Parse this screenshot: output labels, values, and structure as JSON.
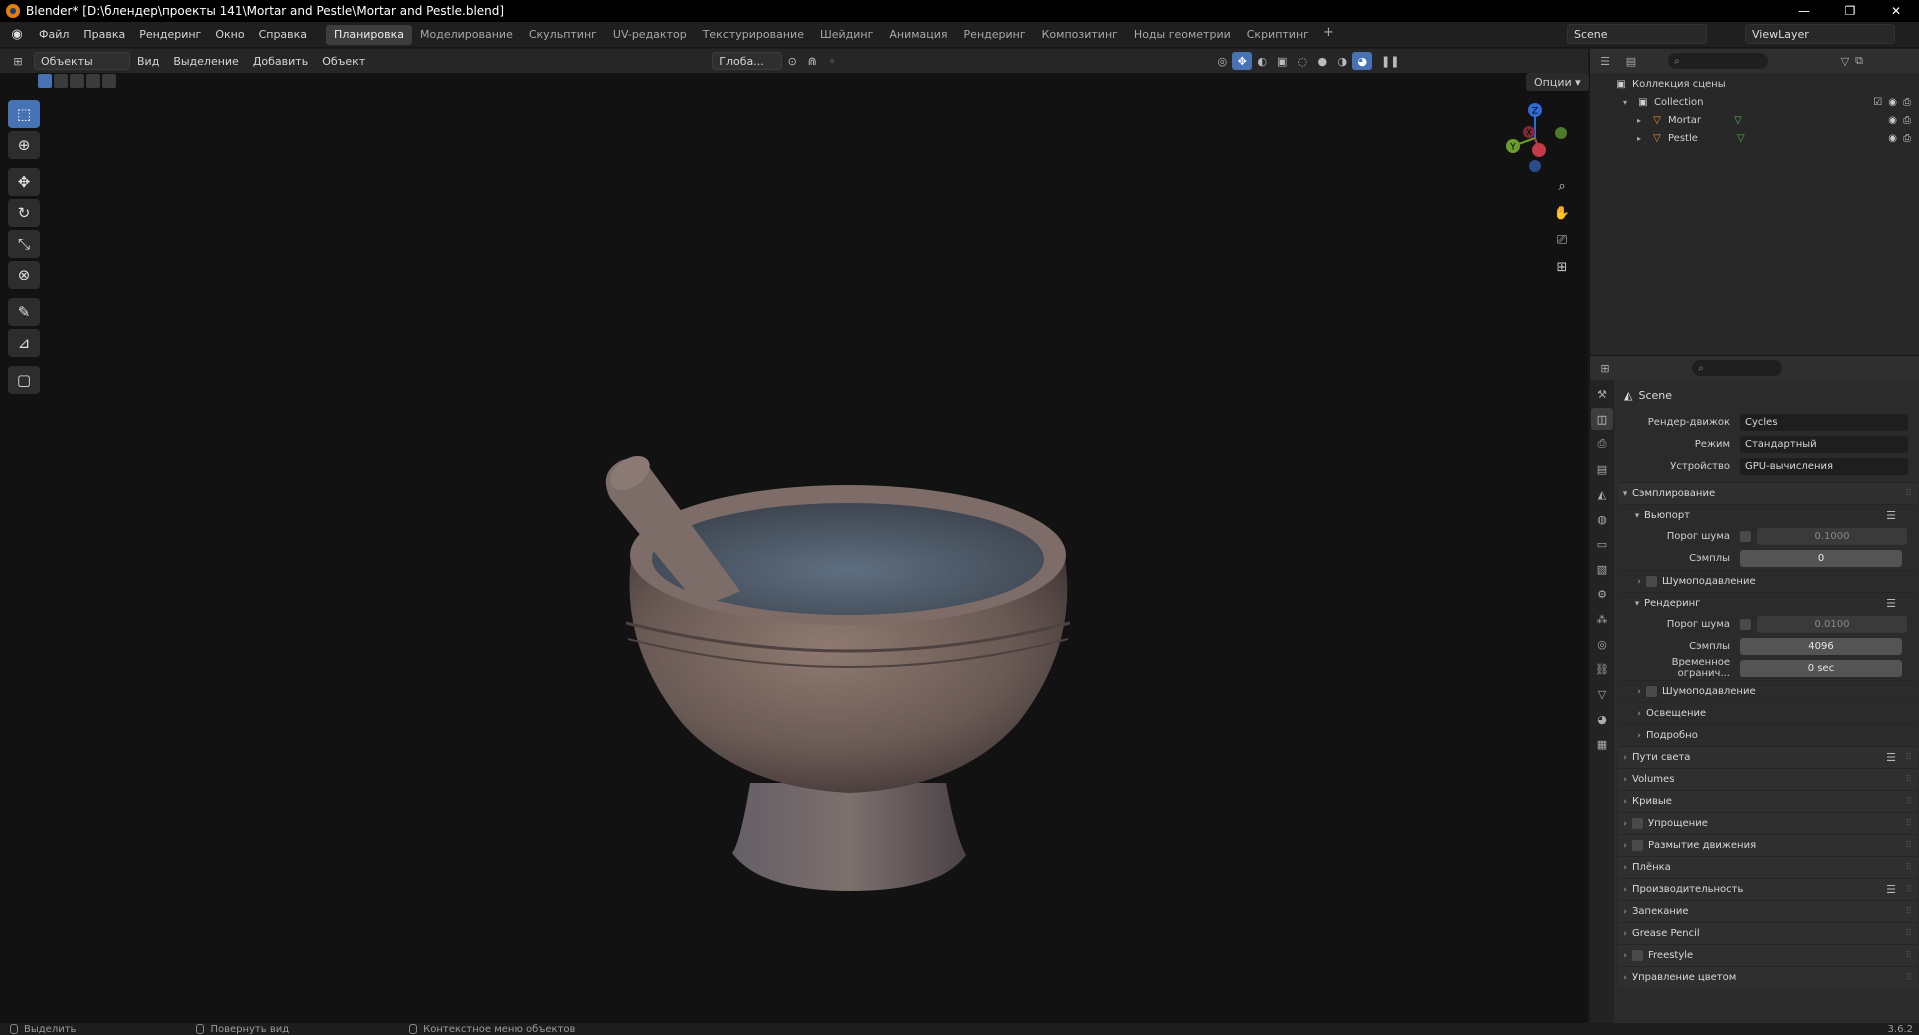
{
  "window": {
    "title": "Blender* [D:\\блендер\\проекты 141\\Mortar and Pestle\\Mortar and Pestle.blend]",
    "controls": [
      "—",
      "❐",
      "✕"
    ]
  },
  "menu": [
    "Файл",
    "Правка",
    "Рендеринг",
    "Окно",
    "Справка"
  ],
  "workspaces": [
    "Планировка",
    "Моделирование",
    "Скульптинг",
    "UV-редактор",
    "Текстурирование",
    "Шейдинг",
    "Анимация",
    "Рендеринг",
    "Композитинг",
    "Ноды геометрии",
    "Скриптинг"
  ],
  "active_workspace": "Планировка",
  "scene_name": "Scene",
  "view_layer": "ViewLayer",
  "viewport_header": {
    "mode": "Объекты",
    "menus": [
      "Вид",
      "Выделение",
      "Добавить",
      "Объект"
    ],
    "transform_orientation": "Глоба...",
    "options_label": "Опции"
  },
  "gizmo": {
    "z": "Z",
    "y": "Y",
    "x": "X"
  },
  "outliner": {
    "root": "Коллекция сцены",
    "collection": "Collection",
    "objects": [
      "Mortar",
      "Pestle"
    ]
  },
  "properties": {
    "context": "Scene",
    "render_engine_label": "Рендер-движок",
    "render_engine": "Cycles",
    "mode_label": "Режим",
    "mode": "Стандартный",
    "device_label": "Устройство",
    "device": "GPU-вычисления",
    "sampling": "Сэмплирование",
    "viewport": "Вьюпорт",
    "noise_threshold_label": "Порог шума",
    "vp_noise_threshold": "0.1000",
    "samples_label": "Сэмплы",
    "vp_samples": "0",
    "denoise": "Шумоподавление",
    "render": "Рендеринг",
    "r_noise_threshold": "0.0100",
    "r_samples": "4096",
    "time_limit_label": "Временное огранич...",
    "time_limit": "0 sec",
    "denoise2": "Шумоподавление",
    "lighting": "Освещение",
    "advanced": "Подробно",
    "panels": [
      "Пути света",
      "Volumes",
      "Кривые",
      "Упрощение",
      "Размытие движения",
      "Плёнка",
      "Производительность",
      "Запекание",
      "Grease Pencil",
      "Freestyle",
      "Управление цветом"
    ]
  },
  "status": {
    "select": "Выделить",
    "rotate": "Повернуть вид",
    "context_menu": "Контекстное меню объектов",
    "version": "3.6.2"
  }
}
